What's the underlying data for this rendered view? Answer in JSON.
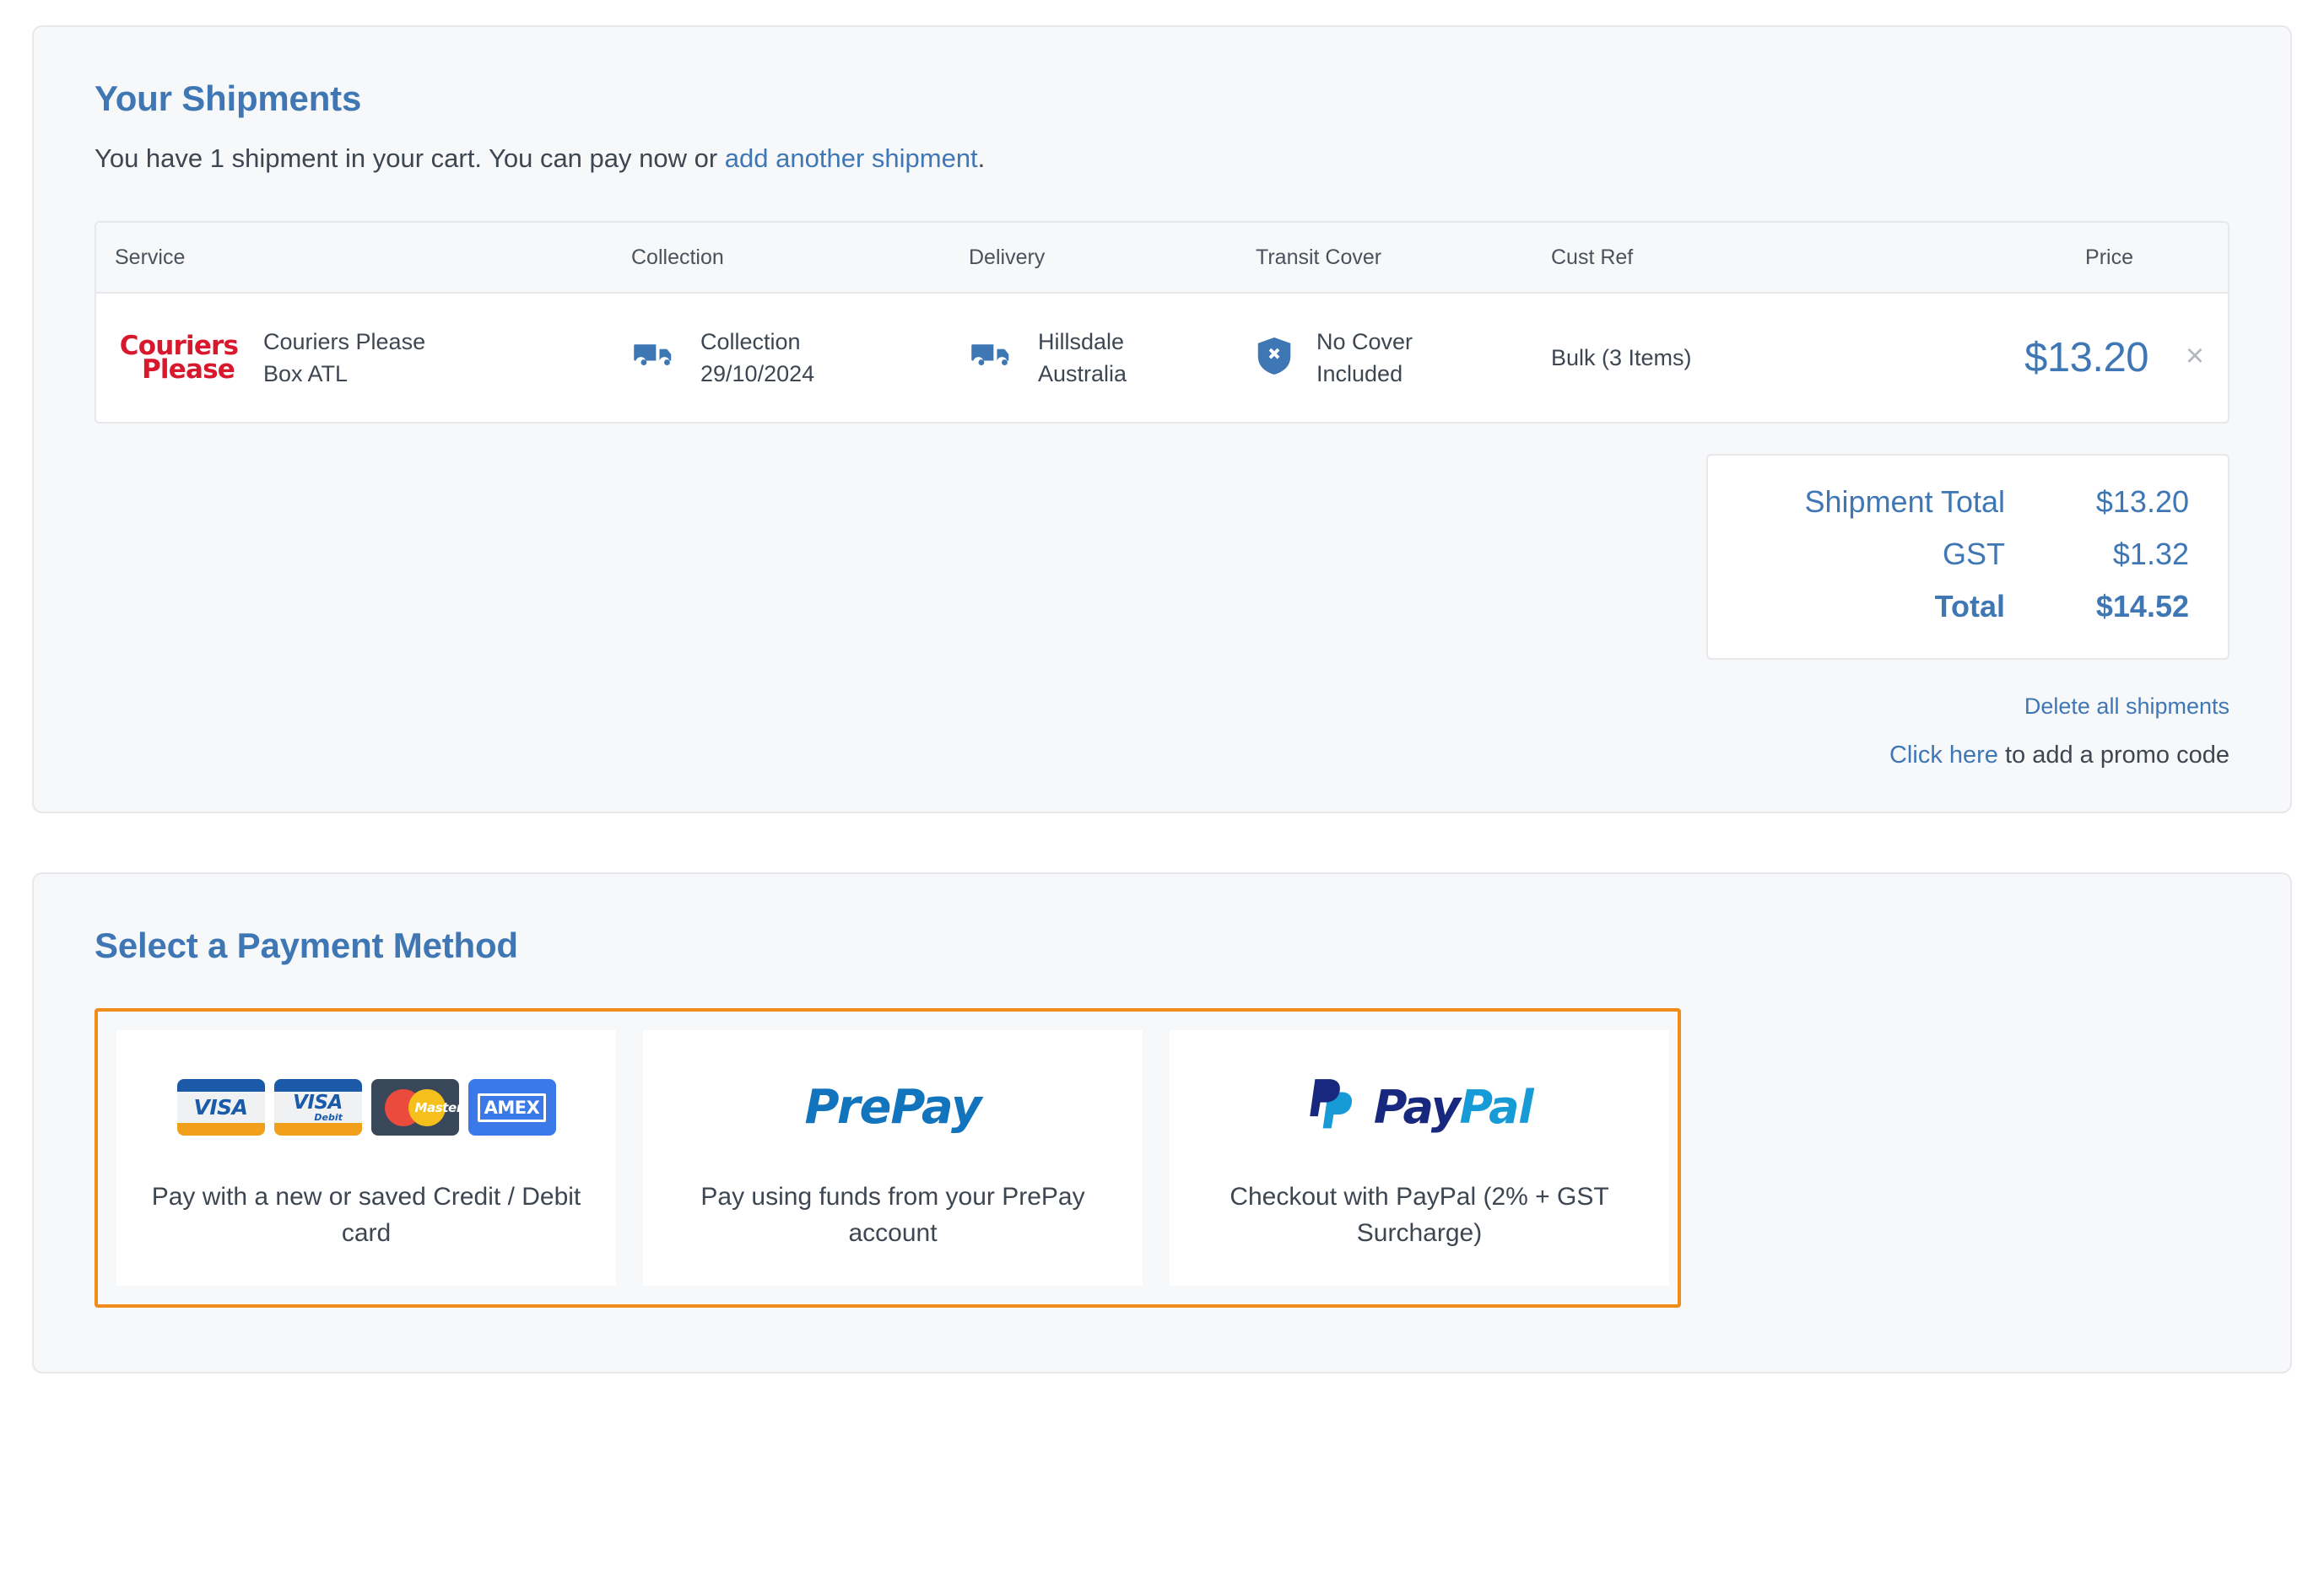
{
  "shipments": {
    "title": "Your Shipments",
    "subtitle_before": "You have 1 shipment in your cart. You can pay now or ",
    "subtitle_link": "add another shipment",
    "subtitle_after": ".",
    "table": {
      "headers": [
        "Service",
        "Collection",
        "Delivery",
        "Transit Cover",
        "Cust Ref",
        "Price"
      ],
      "rows": [
        {
          "logo_line1": "Couriers",
          "logo_line2": "Please",
          "service_name": "Couriers Please",
          "service_sub": "Box ATL",
          "collection_label": "Collection",
          "collection_value": "29/10/2024",
          "delivery_label": "Hillsdale",
          "delivery_value": "Australia",
          "cover_label": "No Cover",
          "cover_value": "Included",
          "cust_ref": "Bulk (3 Items)",
          "price": "$13.20",
          "remove_icon": "×"
        }
      ]
    },
    "totals": [
      {
        "label": "Shipment Total",
        "amount": "$13.20"
      },
      {
        "label": "GST",
        "amount": "$1.32"
      },
      {
        "label": "Total",
        "amount": "$14.52"
      }
    ],
    "delete_all_link": "Delete all shipments",
    "promo_link": "Click here",
    "promo_text": " to add a promo code"
  },
  "payment": {
    "title": "Select a Payment Method",
    "selected_index": 0,
    "methods": [
      {
        "id": "credit-debit-card",
        "logo_type": "card-brands",
        "brands": [
          "VISA",
          "VISA Debit",
          "MasterCard",
          "AMEX"
        ],
        "desc": "Pay with a new or saved Credit / Debit card"
      },
      {
        "id": "prepay",
        "logo_type": "prepay-wordmark",
        "wordmark": "PrePay",
        "desc": "Pay using funds from your PrePay account"
      },
      {
        "id": "paypal",
        "logo_type": "paypal-wordmark",
        "wordmark_dark": "Pay",
        "wordmark_light": "Pal",
        "desc": "Checkout with PayPal (2% + GST Surcharge)"
      }
    ]
  },
  "colors": {
    "accent_blue": "#3f77b5",
    "text": "#3d4651",
    "panel_bg": "#f7f8fa",
    "border": "#e6e8eb",
    "selection_orange": "#f08c1a",
    "courier_red": "#d8182c"
  }
}
